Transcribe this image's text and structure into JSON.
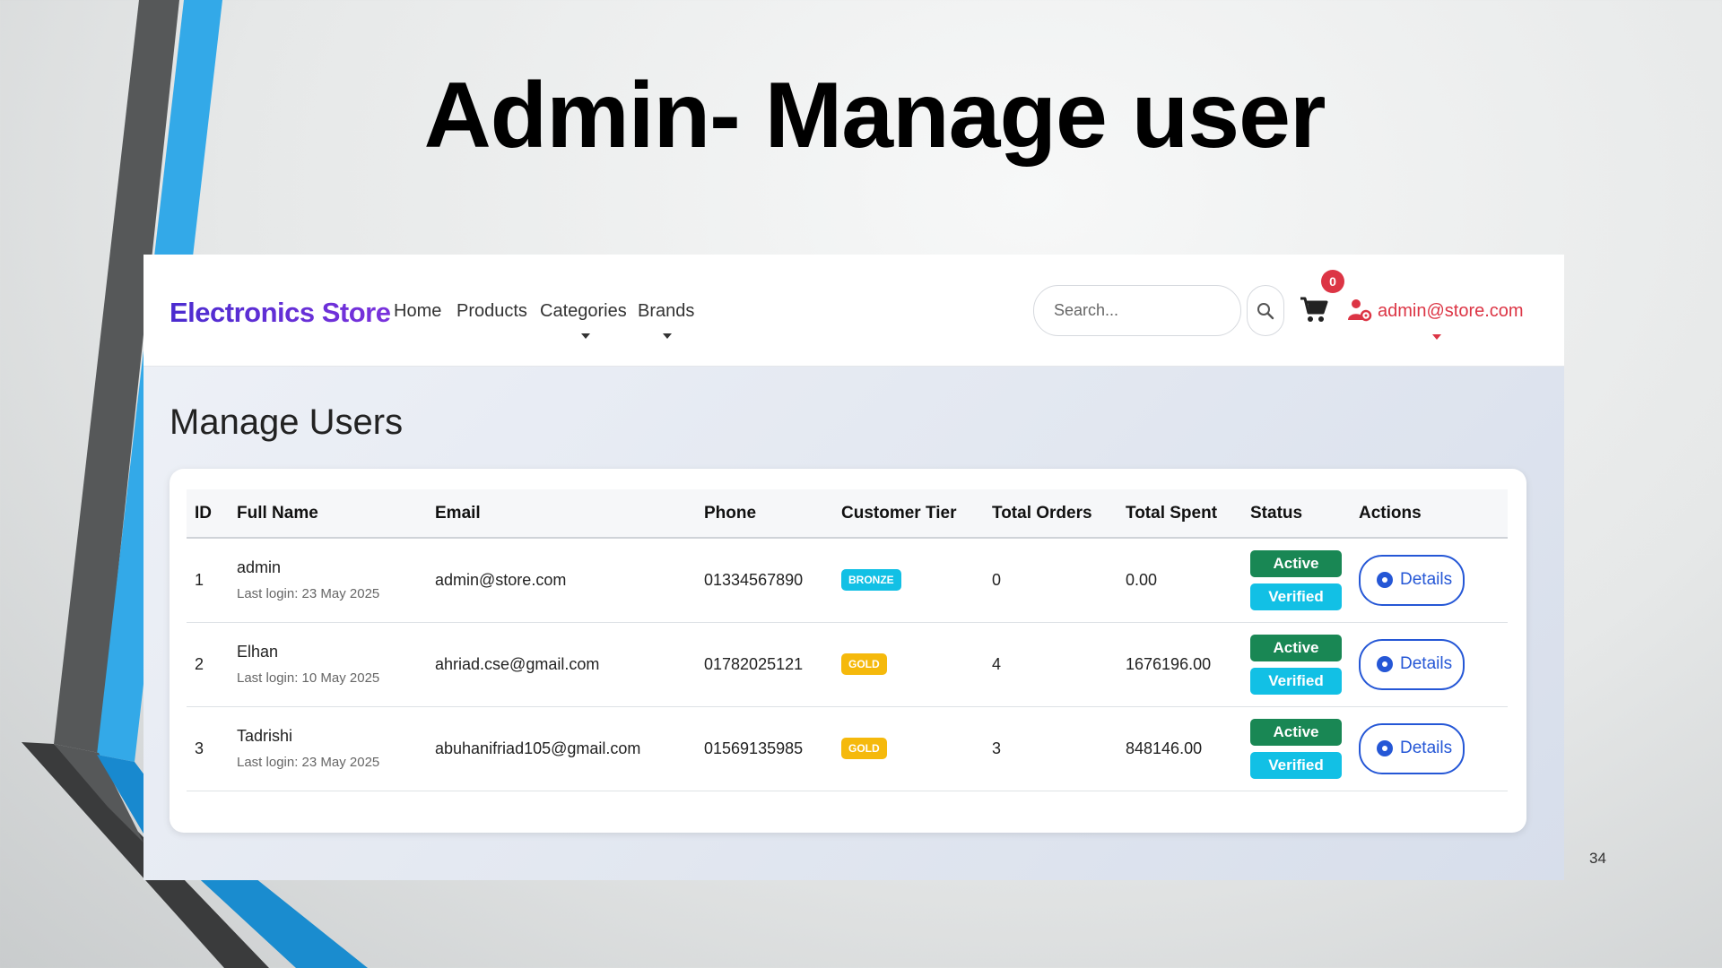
{
  "slide": {
    "title": "Admin- Manage user",
    "page_number": "34"
  },
  "navbar": {
    "brand": "Electronics Store",
    "links": [
      {
        "label": "Home",
        "has_dropdown": false
      },
      {
        "label": "Products",
        "has_dropdown": false
      },
      {
        "label": "Categories",
        "has_dropdown": true
      },
      {
        "label": "Brands",
        "has_dropdown": true
      }
    ],
    "search_placeholder": "Search...",
    "cart_count": "0",
    "user_email": "admin@store.com",
    "icons": [
      "search-icon",
      "cart-icon",
      "user-gear-icon"
    ]
  },
  "main": {
    "heading": "Manage Users",
    "table": {
      "headers": [
        "ID",
        "Full Name",
        "Email",
        "Phone",
        "Customer Tier",
        "Total Orders",
        "Total Spent",
        "Status",
        "Actions"
      ],
      "rows": [
        {
          "id": "1",
          "name": "admin",
          "last_login": "Last login: 23 May 2025",
          "email": "admin@store.com",
          "phone": "01334567890",
          "tier": "BRONZE",
          "orders": "0",
          "spent": "0.00",
          "status": "Active",
          "verified": "Verified",
          "action": "Details"
        },
        {
          "id": "2",
          "name": "Elhan",
          "last_login": "Last login: 10 May 2025",
          "email": "ahriad.cse@gmail.com",
          "phone": "01782025121",
          "tier": "GOLD",
          "orders": "4",
          "spent": "1676196.00",
          "status": "Active",
          "verified": "Verified",
          "action": "Details"
        },
        {
          "id": "3",
          "name": "Tadrishi",
          "last_login": "Last login: 23 May 2025",
          "email": "abuhanifriad105@gmail.com",
          "phone": "01569135985",
          "tier": "GOLD",
          "orders": "3",
          "spent": "848146.00",
          "status": "Active",
          "verified": "Verified",
          "action": "Details"
        }
      ]
    }
  },
  "colors": {
    "brand_gradient_start": "#4b2ccf",
    "brand_gradient_end": "#7a32dc",
    "danger": "#dc3545",
    "success": "#198754",
    "info": "#12c0e5",
    "warning": "#f5b90c",
    "primary": "#2557d6"
  }
}
